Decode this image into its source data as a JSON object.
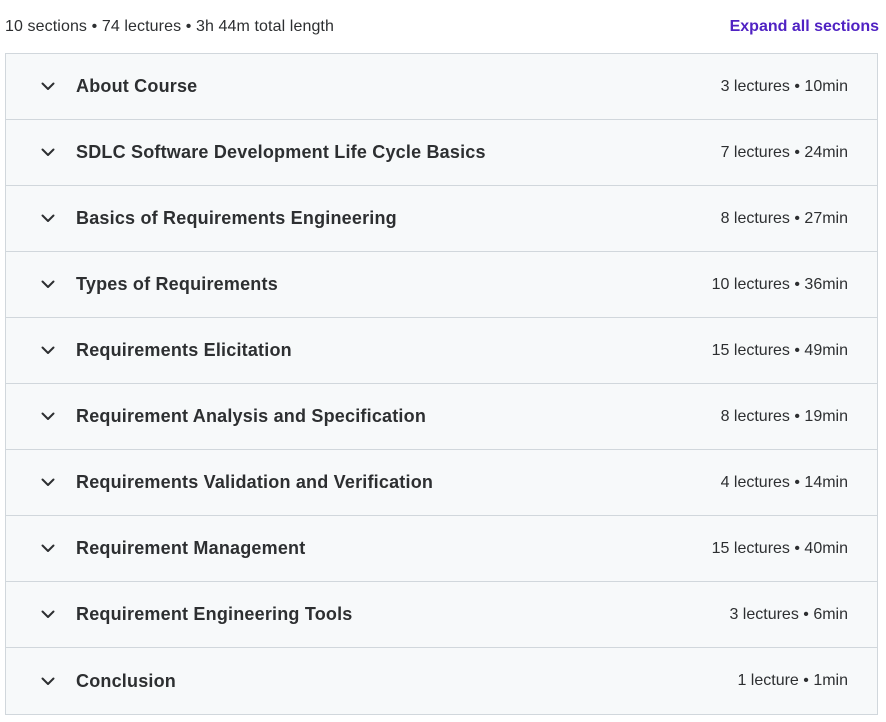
{
  "summary": {
    "text": "10 sections • 74 lectures • 3h 44m total length",
    "expand_label": "Expand all sections"
  },
  "icons": {
    "chevron": "chevron-down-icon"
  },
  "colors": {
    "accent": "#5022c3",
    "row_background": "#f7f9fa",
    "border": "#d1d7dc",
    "text": "#2d2f31"
  },
  "sections": [
    {
      "title": "About Course",
      "meta": "3 lectures • 10min"
    },
    {
      "title": "SDLC Software Development Life Cycle Basics",
      "meta": "7 lectures • 24min"
    },
    {
      "title": "Basics of Requirements Engineering",
      "meta": "8 lectures • 27min"
    },
    {
      "title": "Types of Requirements",
      "meta": "10 lectures • 36min"
    },
    {
      "title": "Requirements Elicitation",
      "meta": "15 lectures • 49min"
    },
    {
      "title": "Requirement Analysis and Specification",
      "meta": "8 lectures • 19min"
    },
    {
      "title": "Requirements Validation and Verification",
      "meta": "4 lectures • 14min"
    },
    {
      "title": "Requirement Management",
      "meta": "15 lectures • 40min"
    },
    {
      "title": "Requirement Engineering Tools",
      "meta": "3 lectures • 6min"
    },
    {
      "title": "Conclusion",
      "meta": "1 lecture • 1min"
    }
  ]
}
